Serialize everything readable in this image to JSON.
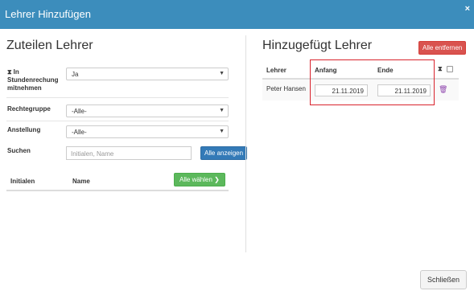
{
  "dialog": {
    "title": "Lehrer Hinzufügen",
    "close_glyph": "×"
  },
  "left": {
    "heading": "Zuteilen Lehrer",
    "in_stundenrechnung": {
      "label_line1": "In",
      "label_line2": "Stundenrechung",
      "label_line3": "mitnehmen",
      "icon": "hourglass-icon",
      "value": "Ja"
    },
    "rechtegruppe": {
      "label": "Rechtegruppe",
      "value": "-Alle-"
    },
    "anstellung": {
      "label": "Anstellung",
      "value": "-Alle-"
    },
    "suchen": {
      "label": "Suchen",
      "placeholder": "Initialen, Name",
      "button": "Alle anzeigen"
    },
    "table": {
      "col_initialen": "Initialen",
      "col_name": "Name",
      "select_all": "Alle wählen",
      "select_all_glyph": "❯"
    }
  },
  "right": {
    "heading": "Hinzugefügt Lehrer",
    "remove_all": "Alle entfernen",
    "columns": {
      "lehrer": "Lehrer",
      "anfang": "Anfang",
      "ende": "Ende"
    },
    "rows": [
      {
        "lehrer": "Peter Hansen",
        "anfang": "21.11.2019",
        "ende": "21.11.2019"
      }
    ]
  },
  "footer": {
    "close_button": "Schließen"
  },
  "colors": {
    "titlebar": "#3c8dbc",
    "primary": "#337ab7",
    "success": "#5cb85c",
    "danger": "#d9534f",
    "highlight_border": "#d9232d"
  }
}
